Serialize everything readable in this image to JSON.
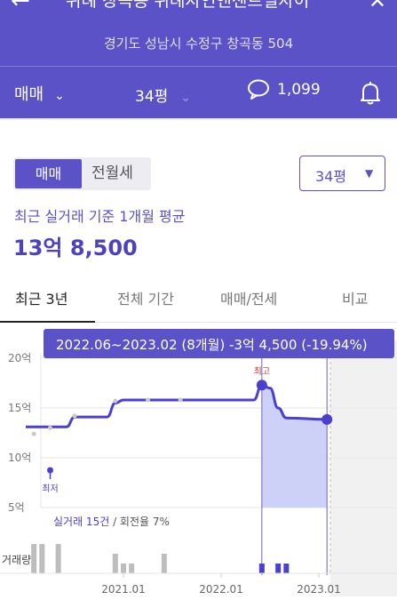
{
  "header": {
    "title": "위례 창곡동 위례자연앤센트럴자이",
    "address": "경기도 성남시 수정구 창곡동 504",
    "deal_filter": "매매",
    "size_filter": "34평",
    "comment_count": "1,099"
  },
  "toggle": {
    "active": "매매",
    "inactive": "전월세"
  },
  "size_select": "34평",
  "average": {
    "label": "최근 실거래 기준 1개월 평균",
    "value": "13억 8,500"
  },
  "tabs": [
    "최근 3년",
    "전체 기간",
    "매매/전세",
    "비교"
  ],
  "active_tab": "최근 3년",
  "colors": {
    "brand": "#5b52c8",
    "line": "#4a3fcf",
    "fill": "#c8ccf6",
    "highlight_bar": "#4a3fcf",
    "bar": "#bdbdbd"
  },
  "chart_data": {
    "type": "line",
    "tooltip": "2022.06~2023.02 (8개월)  -3억 4,500 (-19.94%)",
    "y_ticks": [
      "20억",
      "15억",
      "10억",
      "5억"
    ],
    "x_ticks": [
      "2021.01",
      "2022.01",
      "2023.01"
    ],
    "ylim": [
      5,
      20
    ],
    "unit": "억",
    "line": [
      {
        "x": "2020.01",
        "y": 13.1
      },
      {
        "x": "2020.03",
        "y": 13.1
      },
      {
        "x": "2020.06",
        "y": 13.1
      },
      {
        "x": "2020.07",
        "y": 14.1
      },
      {
        "x": "2020.09",
        "y": 14.1
      },
      {
        "x": "2020.11",
        "y": 14.1
      },
      {
        "x": "2020.12",
        "y": 15.5
      },
      {
        "x": "2021.01",
        "y": 15.8
      },
      {
        "x": "2021.06",
        "y": 15.8
      },
      {
        "x": "2021.12",
        "y": 15.8
      },
      {
        "x": "2022.05",
        "y": 15.8
      },
      {
        "x": "2022.06",
        "y": 17.3
      },
      {
        "x": "2022.07",
        "y": 17.0
      },
      {
        "x": "2022.08",
        "y": 15.0
      },
      {
        "x": "2022.09",
        "y": 14.0
      },
      {
        "x": "2023.02",
        "y": 13.85
      }
    ],
    "transactions": [
      {
        "x": "2020.02",
        "y": 12.4
      },
      {
        "x": "2020.04",
        "y": 13.0
      },
      {
        "x": "2020.07",
        "y": 14.2
      },
      {
        "x": "2020.12",
        "y": 15.7
      },
      {
        "x": "2021.04",
        "y": 15.8
      },
      {
        "x": "2021.08",
        "y": 15.8
      },
      {
        "x": "2022.06",
        "y": 17.3
      }
    ],
    "annotations": {
      "max": "최고",
      "min": "최저"
    },
    "stats": {
      "count_label": "실거래 15건",
      "turnover_label": "회전율 7%"
    },
    "volume_label": "거래량",
    "volume": [
      {
        "x": "2020.02",
        "v": 3
      },
      {
        "x": "2020.03",
        "v": 3
      },
      {
        "x": "2020.05",
        "v": 3
      },
      {
        "x": "2020.12",
        "v": 2
      },
      {
        "x": "2021.01",
        "v": 1
      },
      {
        "x": "2021.02",
        "v": 1
      },
      {
        "x": "2021.06",
        "v": 2
      },
      {
        "x": "2022.06",
        "v": 1
      },
      {
        "x": "2022.08",
        "v": 1
      },
      {
        "x": "2022.09",
        "v": 1
      }
    ],
    "highlight_range": [
      "2022.06",
      "2023.02"
    ]
  }
}
